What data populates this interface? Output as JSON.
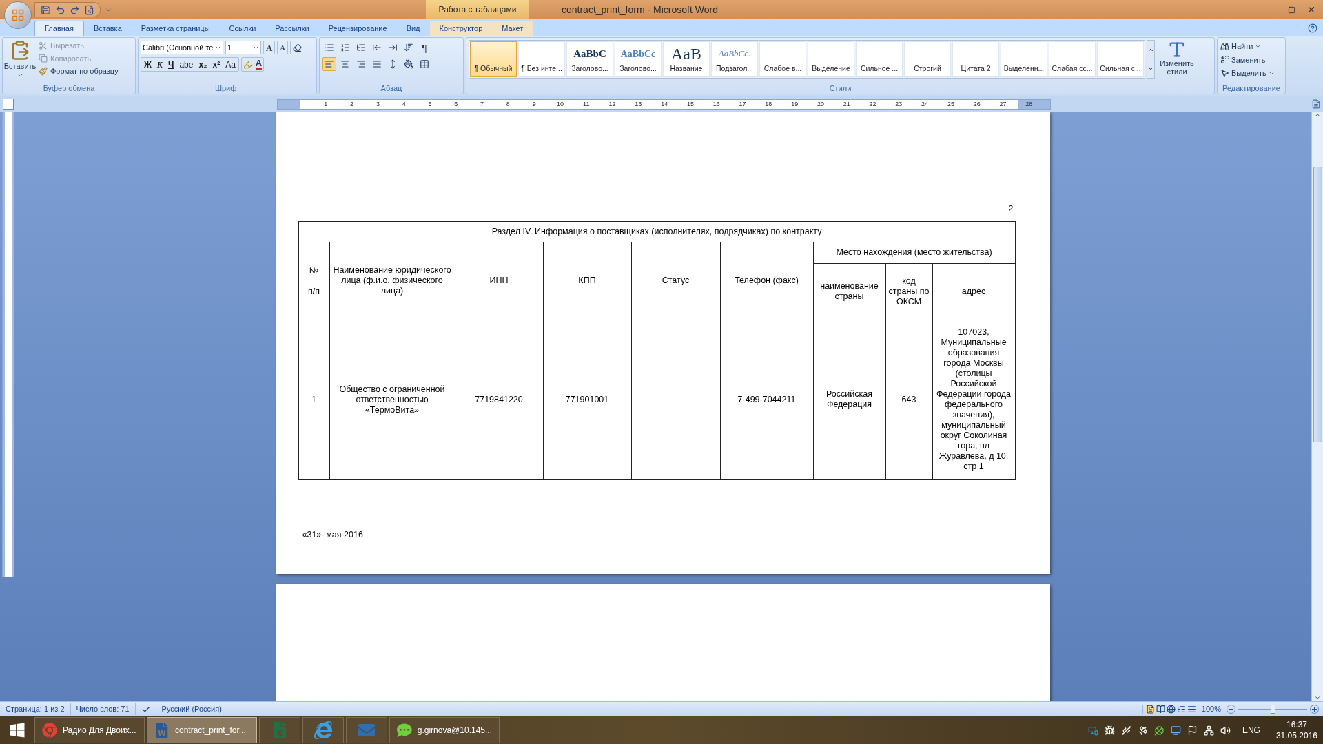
{
  "title_bar": {
    "context_tab": "Работа с таблицами",
    "title": "contract_print_form - Microsoft Word"
  },
  "tabs": [
    {
      "label": "Главная",
      "selected": true,
      "contextual": false
    },
    {
      "label": "Вставка",
      "selected": false,
      "contextual": false
    },
    {
      "label": "Разметка страницы",
      "selected": false,
      "contextual": false
    },
    {
      "label": "Ссылки",
      "selected": false,
      "contextual": false
    },
    {
      "label": "Рассылки",
      "selected": false,
      "contextual": false
    },
    {
      "label": "Рецензирование",
      "selected": false,
      "contextual": false
    },
    {
      "label": "Вид",
      "selected": false,
      "contextual": false
    },
    {
      "label": "Конструктор",
      "selected": false,
      "contextual": true
    },
    {
      "label": "Макет",
      "selected": false,
      "contextual": true
    }
  ],
  "ribbon": {
    "clipboard": {
      "paste": "Вставить",
      "cut": "Вырезать",
      "copy": "Копировать",
      "format_painter": "Формат по образцу",
      "label": "Буфер обмена"
    },
    "font": {
      "font_name": "Calibri (Основной те",
      "font_size": "1",
      "grow": "A",
      "shrink": "A",
      "font_color": "A",
      "label": "Шрифт",
      "format_buttons": [
        {
          "text": "Ж",
          "kind": "bold"
        },
        {
          "text": "К",
          "kind": "italic"
        },
        {
          "text": "Ч",
          "kind": "underline"
        },
        {
          "text": "abe",
          "kind": "strike"
        },
        {
          "text": "x₂",
          "kind": "sub"
        },
        {
          "text": "x²",
          "kind": "sup"
        },
        {
          "text": "Aa",
          "kind": "case"
        }
      ]
    },
    "paragraph": {
      "show_marks": "¶",
      "label": "Абзац",
      "alignments": [
        {
          "selected": true
        },
        {
          "selected": false
        },
        {
          "selected": false
        },
        {
          "selected": false
        }
      ]
    },
    "styles": {
      "label": "Стили",
      "change_styles": "Изменить стили",
      "items": [
        {
          "label": "¶ Обычный",
          "kind": "dash",
          "color": "#404040",
          "selected": true
        },
        {
          "label": "¶ Без инте...",
          "kind": "dash",
          "color": "#404040",
          "selected": false
        },
        {
          "label": "Заголово...",
          "kind": "heading1",
          "preview": "AaBbC",
          "selected": false
        },
        {
          "label": "Заголово...",
          "kind": "heading2",
          "preview": "AaBbCc",
          "selected": false
        },
        {
          "label": "Название",
          "kind": "title",
          "preview": "AaB",
          "selected": false
        },
        {
          "label": "Подзагол...",
          "kind": "subtitle",
          "preview": "AaBbCc.",
          "selected": false
        },
        {
          "label": "Слабое в...",
          "kind": "dash",
          "color": "#a0a0a0",
          "selected": false
        },
        {
          "label": "Выделение",
          "kind": "dash",
          "color": "#404040",
          "selected": false
        },
        {
          "label": "Сильное ...",
          "kind": "dash",
          "color": "#4f81bd",
          "selected": false
        },
        {
          "label": "Строгий",
          "kind": "dash",
          "color": "#202020",
          "selected": false
        },
        {
          "label": "Цитата 2",
          "kind": "dash",
          "color": "#202020",
          "selected": false
        },
        {
          "label": "Выделенн...",
          "kind": "underlined",
          "color": "#4f81bd",
          "selected": false
        },
        {
          "label": "Слабая сс...",
          "kind": "dash",
          "color": "#c0504d",
          "selected": false
        },
        {
          "label": "Сильная с...",
          "kind": "dash",
          "color": "#c0504d",
          "selected": false
        }
      ]
    },
    "editing": {
      "find": "Найти",
      "replace": "Заменить",
      "select": "Выделить",
      "label": "Редактирование"
    }
  },
  "ruler": [
    "1",
    "2",
    "3",
    "4",
    "5",
    "6",
    "7",
    "8",
    "9",
    "10",
    "11",
    "12",
    "13",
    "14",
    "15",
    "16",
    "17",
    "18",
    "19",
    "20",
    "21",
    "22",
    "23",
    "24",
    "25",
    "26",
    "27",
    "28"
  ],
  "document": {
    "page_number": "2",
    "table": {
      "caption": "Раздел IV. Информация о поставщиках (исполнителях, подрядчиках) по контракту",
      "columns": [
        "№ п/п",
        "Наименование юридического лица (ф.и.о. физического лица)",
        "ИНН",
        "КПП",
        "Статус",
        "Телефон (факс)"
      ],
      "location_group": "Место нахождения (место жительства)",
      "location_columns": [
        "наименование страны",
        "код страны по ОКСМ",
        "адрес"
      ],
      "rows": [
        {
          "number": "1",
          "name": "Общество с ограниченной ответственностью «ТермоВита»",
          "inn": "7719841220",
          "kpp": "771901001",
          "phone": "7-499-7044211",
          "country": "Российская Федерация",
          "country_code": "643",
          "address": "107023, Муниципальные образования города Москвы (столицы Российской Федерации города федерального значения), муниципальный округ Соколиная гора, пл Журавлева, д 10, стр 1"
        }
      ]
    },
    "date_line": "«31»  мая 2016"
  },
  "status_bar": {
    "page": "Страница: 1 из 2",
    "words": "Число слов: 71",
    "language": "Русский (Россия)",
    "zoom": "100%",
    "zoom_slider": {
      "level": 0.5
    }
  },
  "taskbar": {
    "items": [
      {
        "label": "Радио Для Двоих...",
        "kind": "browser",
        "active": false
      },
      {
        "label": "contract_print_for...",
        "kind": "word",
        "active": true
      },
      {
        "kind": "spreadsheet",
        "active": false
      },
      {
        "kind": "ie",
        "active": false
      },
      {
        "kind": "mail",
        "active": false
      },
      {
        "label": "g.girnova@10.145...",
        "kind": "chat",
        "active": false
      }
    ],
    "language": "ENG",
    "time": "16:37",
    "date": "31.05.2016"
  }
}
